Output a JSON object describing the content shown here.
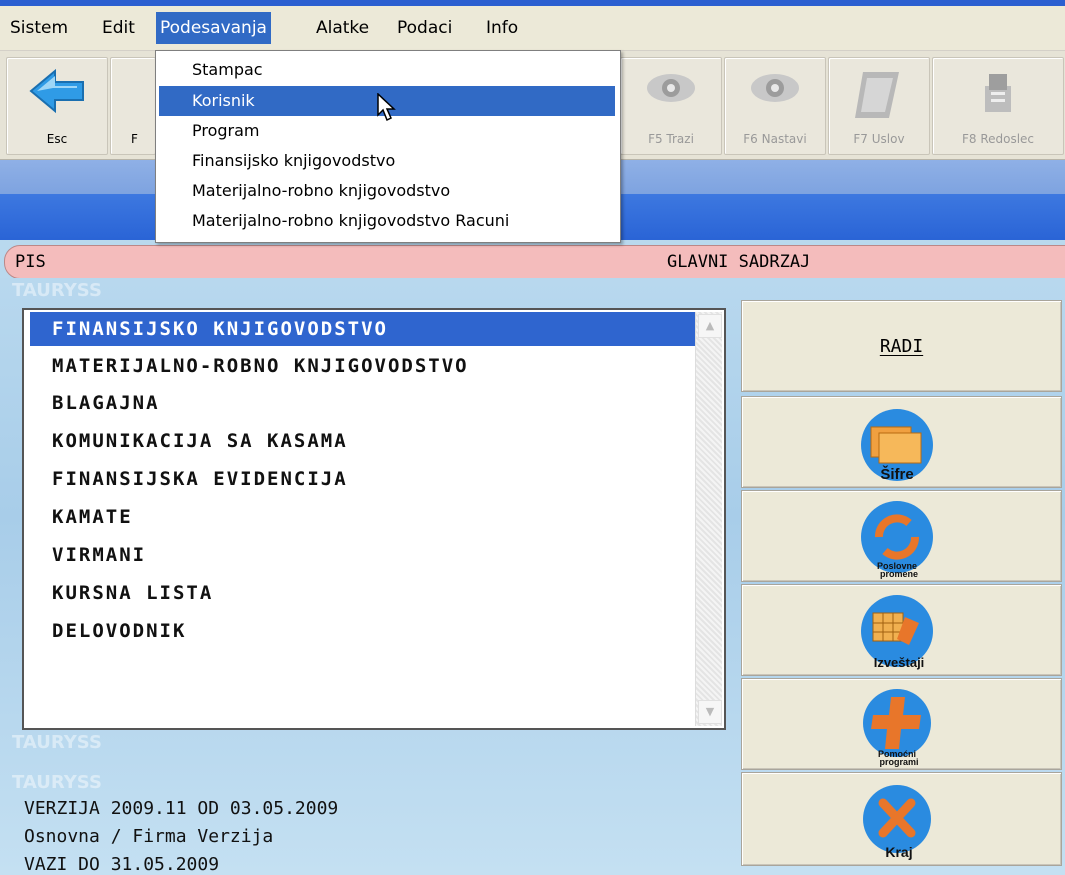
{
  "menubar": {
    "items": [
      "Sistem",
      "Edit",
      "Podesavanja",
      "Alatke",
      "Podaci",
      "Info"
    ]
  },
  "dropdown": {
    "items": [
      "Stampac",
      "Korisnik",
      "Program",
      "Finansijsko knjigovodstvo",
      "Materijalno-robno knjigovodstvo",
      "Materijalno-robno knjigovodstvo Racuni"
    ],
    "highlighted": "Korisnik"
  },
  "toolbar": {
    "buttons": [
      "Esc",
      "F",
      "F5 Trazi",
      "F6 Nastavi",
      "F7 Uslov",
      "F8 Redoslec"
    ]
  },
  "statusbar": {
    "left": "PIS",
    "right": "GLAVNI SADRZAJ"
  },
  "watermark": "TAURYSS",
  "list": {
    "items": [
      "FINANSIJSKO KNJIGOVODSTVO",
      "MATERIJALNO-ROBNO KNJIGOVODSTVO",
      "BLAGAJNA",
      "KOMUNIKACIJA SA KASAMA",
      "FINANSIJSKA EVIDENCIJA",
      "KAMATE",
      "VIRMANI",
      "KURSNA LISTA",
      "DELOVODNIK"
    ],
    "selected": "FINANSIJSKO KNJIGOVODSTVO"
  },
  "right_buttons": {
    "radi": "RADI",
    "sifre": "Šifre",
    "poslovne_1": "Poslovne",
    "poslovne_2": "promene",
    "izvestaji": "Izveštaji",
    "pomocni_1": "Pomoćni",
    "pomocni_2": "programi",
    "kraj": "Kraj"
  },
  "version": {
    "line1": "VERZIJA 2009.11 OD 03.05.2009",
    "line2": "Osnovna / Firma Verzija",
    "line3": "VAZI DO 31.05.2009"
  },
  "colors": {
    "highlight": "#316ac5",
    "selection": "#2f65cf",
    "status_bg": "#f4bcbc",
    "accent_orange": "#e8762a",
    "accent_blue": "#2a7ad0"
  }
}
